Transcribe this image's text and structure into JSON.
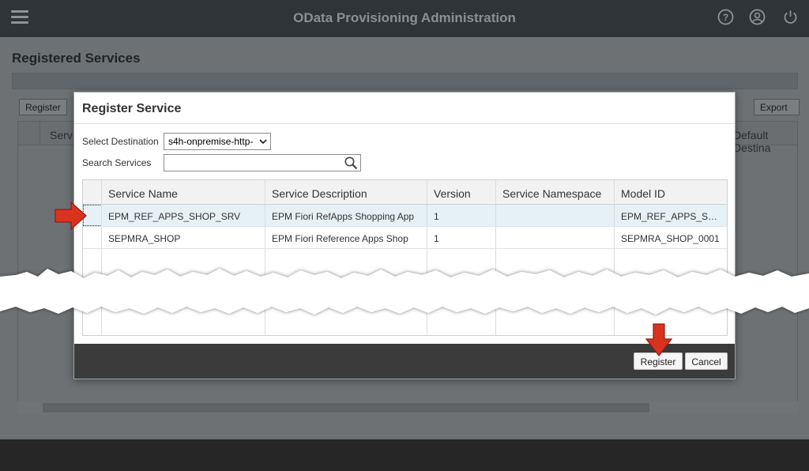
{
  "shell": {
    "title": "OData Provisioning Administration",
    "icons": [
      "menu-icon",
      "help-icon",
      "user-icon",
      "power-icon"
    ]
  },
  "page": {
    "title": "Registered Services",
    "register_label": "Register",
    "export_label": "Export",
    "columns": [
      "Serv",
      "Default Destina"
    ]
  },
  "dialog": {
    "title": "Register Service",
    "destination_label": "Select Destination",
    "destination_value": "s4h-onpremise-http-",
    "search_label": "Search Services",
    "search_value": "",
    "columns": [
      "Service Name",
      "Service Description",
      "Version",
      "Service Namespace",
      "Model ID"
    ],
    "rows": [
      {
        "name": "EPM_REF_APPS_SHOP_SRV",
        "description": "EPM Fiori RefApps Shopping App",
        "version": "1",
        "namespace": "",
        "model_id": "EPM_REF_APPS_SHOP_SRV",
        "selected": true
      },
      {
        "name": "SEPMRA_SHOP",
        "description": "EPM Fiori Reference Apps Shop",
        "version": "1",
        "namespace": "",
        "model_id": "SEPMRA_SHOP_0001"
      }
    ],
    "register_button": "Register",
    "cancel_button": "Cancel"
  },
  "colors": {
    "shell_bg": "#2f3438",
    "overlay_page": "#6d7173",
    "selected_row": "#e5f0f7",
    "dialog_footer": "#3b3b3b",
    "annotation_arrow": "#d9331f"
  }
}
